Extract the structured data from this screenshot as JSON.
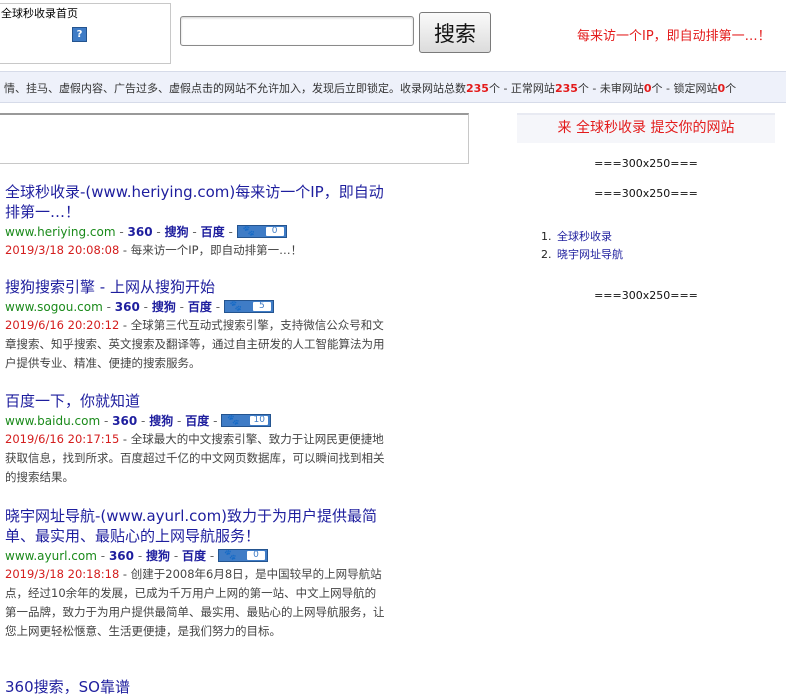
{
  "header": {
    "logo_text": "全球秒收录首页",
    "help_icon": "?",
    "search_placeholder": "",
    "search_value": "",
    "search_button": "搜索",
    "slogan": "每来访一个IP，即自动排第一…！"
  },
  "notice": {
    "text": "情、挂马、虚假内容、广告过多、虚假点击的网站不允许加入，发现后立即锁定。收录网站总数",
    "total": "235",
    "text2": "个 - 正常网站",
    "normal": "235",
    "text3": "个 - 未审网站",
    "pending": "0",
    "text4": "个 - 锁定网站",
    "locked": "0",
    "text5": "个"
  },
  "results": [
    {
      "title": "全球秒收录-(www.heriying.com)每来访一个IP，即自动排第一…！",
      "domain": "www.heriying.com",
      "links": [
        "360",
        "搜狗",
        "百度"
      ],
      "badge": "0",
      "date": "2019/3/18 20:08:08",
      "desc": "每来访一个IP，即自动排第一…！"
    },
    {
      "title": "搜狗搜索引擎 - 上网从搜狗开始",
      "domain": "www.sogou.com",
      "links": [
        "360",
        "搜狗",
        "百度"
      ],
      "badge": "5",
      "date": "2019/6/16 20:20:12",
      "desc": "全球第三代互动式搜索引擎，支持微信公众号和文章搜索、知乎搜索、英文搜索及翻译等，通过自主研发的人工智能算法为用户提供专业、精准、便捷的搜索服务。"
    },
    {
      "title": "百度一下，你就知道",
      "domain": "www.baidu.com",
      "links": [
        "360",
        "搜狗",
        "百度"
      ],
      "badge": "10",
      "date": "2019/6/16 20:17:15",
      "desc": "全球最大的中文搜索引擎、致力于让网民更便捷地获取信息，找到所求。百度超过千亿的中文网页数据库，可以瞬间找到相关的搜索结果。"
    },
    {
      "title": "晓宇网址导航-(www.ayurl.com)致力于为用户提供最简单、最实用、最贴心的上网导航服务！",
      "domain": "www.ayurl.com",
      "links": [
        "360",
        "搜狗",
        "百度"
      ],
      "badge": "0",
      "date": "2019/3/18 20:18:18",
      "desc": "创建于2008年6月8日，是中国较早的上网导航站点，经过10余年的发展，已成为千万用户上网的第一站、中文上网导航的第一品牌，致力于为用户提供最简单、最实用、最贴心的上网导航服务，让您上网更轻松惬意、生活更便捷，是我们努力的目标。"
    },
    {
      "title": "360搜索，SO靠谱",
      "domain": "",
      "links": [],
      "badge": "",
      "date": "",
      "desc": ""
    }
  ],
  "sidebar": {
    "submit_title": "来 全球秒收录 提交你的网站",
    "ad1": "===300x250===",
    "ad2": "===300x250===",
    "list": [
      {
        "n": "1.",
        "label": "全球秒收录"
      },
      {
        "n": "2.",
        "label": "晓宇网址导航"
      }
    ],
    "ad3": "===300x250==="
  }
}
